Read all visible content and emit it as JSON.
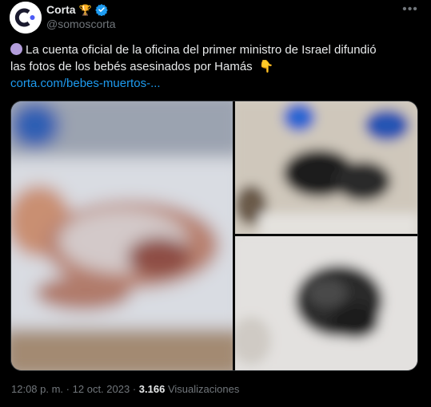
{
  "author": {
    "display_name": "Corta",
    "badge_emoji": "🏆",
    "handle": "@somoscorta",
    "verified": true,
    "avatar_icon": "corta-logo-icon"
  },
  "tweet": {
    "lead_emoji": "purple-circle",
    "text_line1": "La cuenta oficial de la oficina del primer ministro de Israel difundió",
    "text_line2": "las fotos de los bebés asesinados por Hamás",
    "trailing_emoji": "👇",
    "link": "corta.com/bebes-muertos-..."
  },
  "meta": {
    "time": "12:08 p. m.",
    "separator": "·",
    "date": "12 oct. 2023",
    "views_count": "3.166",
    "views_label": "Visualizaciones"
  },
  "colors": {
    "background": "#000000",
    "text_primary": "#e7e9ea",
    "text_secondary": "#71767b",
    "link": "#1d9bf0",
    "verified": "#1d9bf0",
    "avatar_bg": "#ffffff",
    "logo_dark": "#1a1a2e",
    "logo_accent": "#4c5bf5"
  }
}
